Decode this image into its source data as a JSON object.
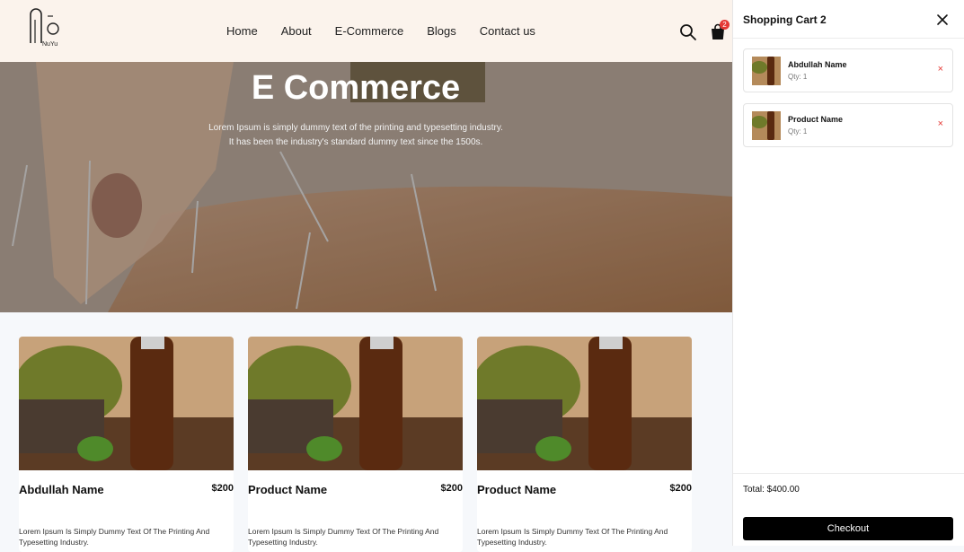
{
  "header": {
    "logo_text": "NuYu",
    "nav": [
      "Home",
      "About",
      "E-Commerce",
      "Blogs",
      "Contact us"
    ],
    "cart_count": "2"
  },
  "hero": {
    "title": "E Commerce",
    "subtitle_line1": "Lorem Ipsum is simply dummy text of the printing and typesetting industry.",
    "subtitle_line2": "It has been the industry's standard dummy text since the 1500s."
  },
  "products": [
    {
      "name": "Abdullah Name",
      "price": "$200",
      "desc": "Lorem Ipsum Is Simply Dummy Text Of The Printing And Typesetting Industry."
    },
    {
      "name": "Product Name",
      "price": "$200",
      "desc": "Lorem Ipsum Is Simply Dummy Text Of The Printing And Typesetting Industry."
    },
    {
      "name": "Product Name",
      "price": "$200",
      "desc": "Lorem Ipsum Is Simply Dummy Text Of The Printing And Typesetting Industry."
    }
  ],
  "cart": {
    "title": "Shopping Cart 2",
    "items": [
      {
        "name": "Abdullah Name",
        "qty": "Qty: 1",
        "remove": "×"
      },
      {
        "name": "Product Name",
        "qty": "Qty: 1",
        "remove": "×"
      }
    ],
    "total": "Total: $400.00",
    "checkout_label": "Checkout"
  },
  "icons": {
    "search": "search-icon",
    "cart": "shopping-bag-icon",
    "close": "close-icon"
  },
  "colors": {
    "header_bg": "#fbf3ec",
    "badge": "#e53935",
    "checkout_bg": "#000000"
  }
}
